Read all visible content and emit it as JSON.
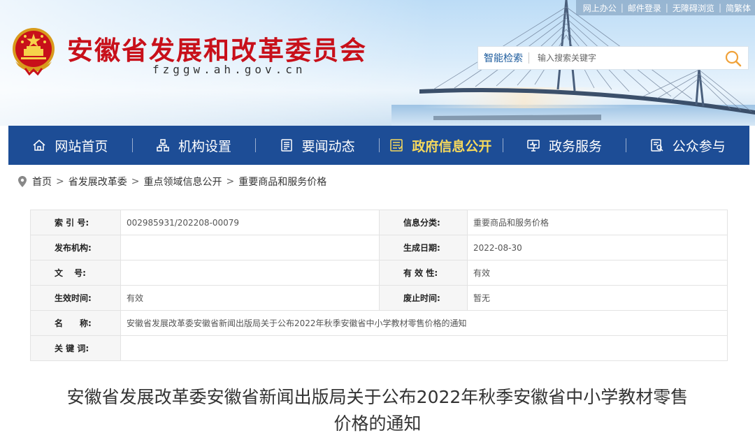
{
  "toplinks": [
    "网上办公",
    "邮件登录",
    "无障碍浏览",
    "简繁体"
  ],
  "site": {
    "title": "安徽省发展和改革委员会",
    "domain": "fzggw.ah.gov.cn"
  },
  "search": {
    "label": "智能检索",
    "placeholder": "输入搜索关键字"
  },
  "nav": [
    {
      "label": "网站首页",
      "icon": "home-icon"
    },
    {
      "label": "机构设置",
      "icon": "org-chart-icon"
    },
    {
      "label": "要闻动态",
      "icon": "news-icon"
    },
    {
      "label": "政府信息公开",
      "icon": "info-disclosure-icon",
      "active": true
    },
    {
      "label": "政务服务",
      "icon": "monitor-icon"
    },
    {
      "label": "公众参与",
      "icon": "participation-icon"
    }
  ],
  "breadcrumb": [
    "首页",
    "省发展改革委",
    "重点领域信息公开",
    "重要商品和服务价格"
  ],
  "info": {
    "index_label": "索 引 号:",
    "index_value": "002985931/202208-00079",
    "category_label": "信息分类:",
    "category_value": "重要商品和服务价格",
    "publisher_label": "发布机构:",
    "publisher_value": "",
    "created_label": "生成日期:",
    "created_value": "2022-08-30",
    "docno_label": "文　 号:",
    "docno_value": "",
    "validity_label": "有 效 性:",
    "validity_value": "有效",
    "effective_label": "生效时间:",
    "effective_value": "有效",
    "expire_label": "废止时间:",
    "expire_value": "暂无",
    "name_label": "名　　称:",
    "name_value": "安徽省发展改革委安徽省新闻出版局关于公布2022年秋季安徽省中小学教材零售价格的通知",
    "keywords_label": "关 键 词:",
    "keywords_value": ""
  },
  "article": {
    "title_line1": "安徽省发展改革委安徽省新闻出版局关于公布2022年秋季安徽省中小学教材零售",
    "title_line2": "价格的通知"
  },
  "colors": {
    "brand_red": "#c8101a",
    "nav_blue": "#1d4d96",
    "nav_active": "#f7d95c",
    "search_icon": "#f0a23a"
  }
}
